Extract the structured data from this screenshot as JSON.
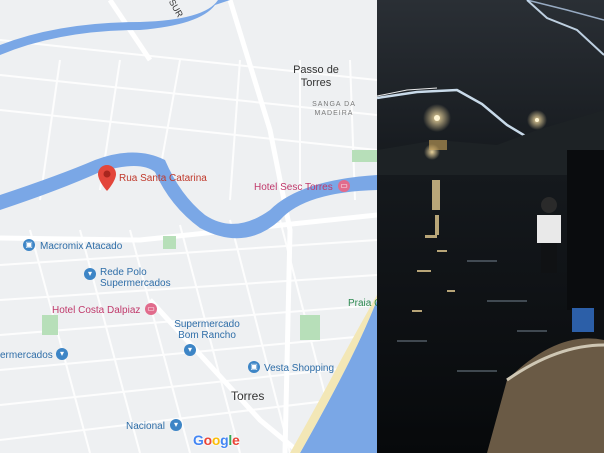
{
  "map": {
    "street_top": "SUR",
    "city_passo_de_torres": "Passo de\nTorres",
    "neighborhood_sanga": "SANGA DA\nMADEIRA",
    "pin_label": "Rua Santa Catarina",
    "hotel_sesc": "Hotel Sesc Torres",
    "macromix": "Macromix Atacado",
    "rede_polo": "Rede Polo\nSupermercados",
    "praia": "Praia C",
    "hotel_costa": "Hotel Costa Dalpiaz",
    "super_bom_rancho": "Supermercado\nBom Rancho",
    "supermercados_left": "ermercados",
    "vesta": "Vesta Shopping",
    "torres": "Torres",
    "nacional": "Nacional",
    "google_logo": "Google",
    "colors": {
      "water": "#7aa7e6",
      "land": "#eef0f2",
      "road": "#ffffff",
      "park": "#b7dfb9",
      "pin": "#e3463b"
    }
  },
  "photo": {
    "description_free": true
  }
}
